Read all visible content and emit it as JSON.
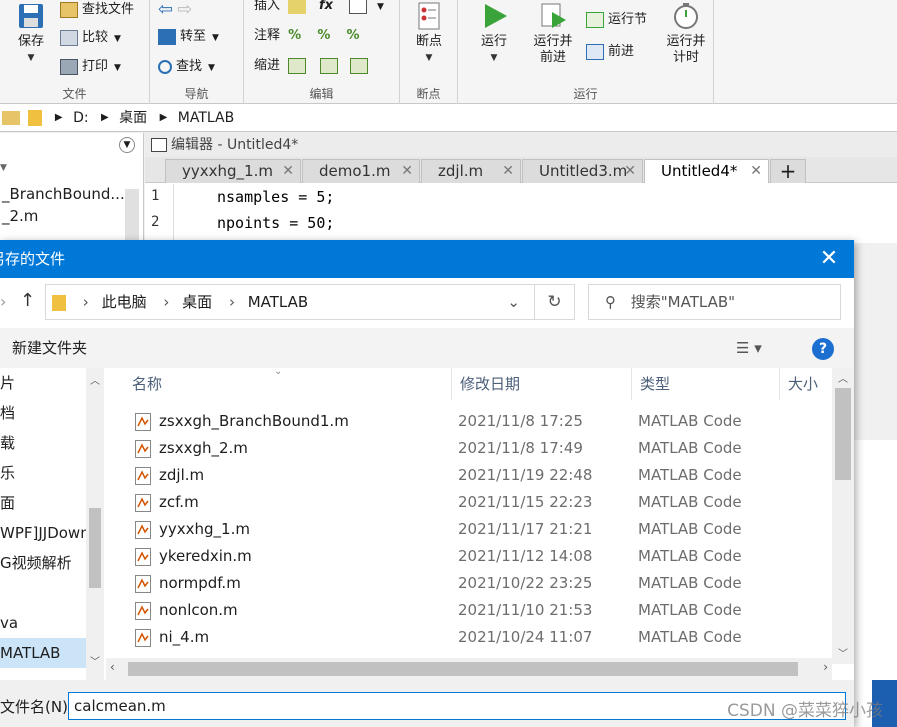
{
  "toolstrip": {
    "file_section": {
      "label": "文件",
      "save": "保存",
      "find_files": "查找文件",
      "compare": "比较",
      "print": "打印"
    },
    "navigate_section": {
      "label": "导航",
      "goto": "转至",
      "find": "查找"
    },
    "edit_section": {
      "label": "编辑",
      "insert": "插入",
      "comment": "注释",
      "indent": "缩进",
      "fx": "fx"
    },
    "breakpoints_section": {
      "label": "断点",
      "breakpoints": "断点"
    },
    "run_section": {
      "label": "运行",
      "run": "运行",
      "run_advance": "运行并\n前进",
      "run_section": "运行节",
      "advance": "前进",
      "run_time": "运行并\n计时"
    }
  },
  "address": {
    "drive": "D:",
    "folder1": "桌面",
    "folder2": "MATLAB"
  },
  "current_folder": {
    "items": [
      "_BranchBound...",
      "_2.m"
    ]
  },
  "editor": {
    "title": "编辑器 - Untitled4*",
    "tabs": [
      "yyxxhg_1.m",
      "demo1.m",
      "zdjl.m",
      "Untitled3.m",
      "Untitled4*"
    ],
    "plus": "+",
    "lines": [
      {
        "num": "1",
        "code": "nsamples = 5;"
      },
      {
        "num": "2",
        "code": "npoints = 50;"
      }
    ]
  },
  "dialog": {
    "title": "另存的文件",
    "close": "✕",
    "path": {
      "pc": "此电脑",
      "desktop": "桌面",
      "matlab": "MATLAB"
    },
    "search_placeholder": "搜索\"MATLAB\"",
    "new_folder": "新建文件夹",
    "help": "?",
    "nav_items": [
      "片",
      "档",
      "载",
      "乐",
      "面",
      "WPF]JJDown",
      "G视频解析",
      "",
      "va",
      "MATLAB"
    ],
    "columns": {
      "name": "名称",
      "date": "修改日期",
      "type": "类型",
      "size": "大小"
    },
    "files": [
      {
        "name": "zsxxgh_BranchBound1.m",
        "date": "2021/11/8 17:25",
        "type": "MATLAB Code"
      },
      {
        "name": "zsxxgh_2.m",
        "date": "2021/11/8 17:49",
        "type": "MATLAB Code"
      },
      {
        "name": "zdjl.m",
        "date": "2021/11/19 22:48",
        "type": "MATLAB Code"
      },
      {
        "name": "zcf.m",
        "date": "2021/11/15 22:23",
        "type": "MATLAB Code"
      },
      {
        "name": "yyxxhg_1.m",
        "date": "2021/11/17 21:21",
        "type": "MATLAB Code"
      },
      {
        "name": "ykeredxin.m",
        "date": "2021/11/12 14:08",
        "type": "MATLAB Code"
      },
      {
        "name": "normpdf.m",
        "date": "2021/10/22 23:25",
        "type": "MATLAB Code"
      },
      {
        "name": "nonlcon.m",
        "date": "2021/11/10 21:53",
        "type": "MATLAB Code"
      },
      {
        "name": "ni_4.m",
        "date": "2021/10/24 11:07",
        "type": "MATLAB Code"
      }
    ],
    "filename_label": "文件名(N):",
    "filename_value": "calcmean.m"
  },
  "watermark": "CSDN @菜菜猝小孩",
  "colors": {
    "accent": "#0078d7",
    "selection": "#cce4f7"
  }
}
